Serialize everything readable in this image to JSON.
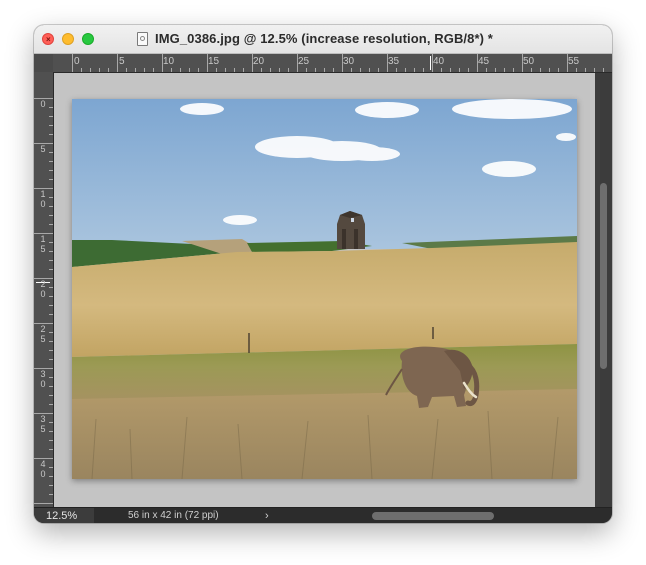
{
  "window": {
    "title": "IMG_0386.jpg @ 12.5% (increase resolution, RGB/8*) *",
    "close_glyph": "×"
  },
  "ruler": {
    "top_labels": [
      "0",
      "5",
      "10",
      "15",
      "20",
      "25",
      "30",
      "35",
      "40",
      "45",
      "50",
      "55"
    ],
    "left_labels": [
      "0",
      "5",
      "10",
      "15",
      "20",
      "25",
      "30",
      "35",
      "40"
    ]
  },
  "document": {
    "image_description_icon": "landscape-photo",
    "colors": {
      "sky": "#88aed3",
      "field": "#c9ae6e",
      "grass": "#9a9446",
      "barn": "#54493f",
      "elephant": "#7e6651"
    }
  },
  "status": {
    "zoom": "12.5%",
    "doc_info": "56 in x 42 in (72 ppi)",
    "arrow": "›"
  }
}
